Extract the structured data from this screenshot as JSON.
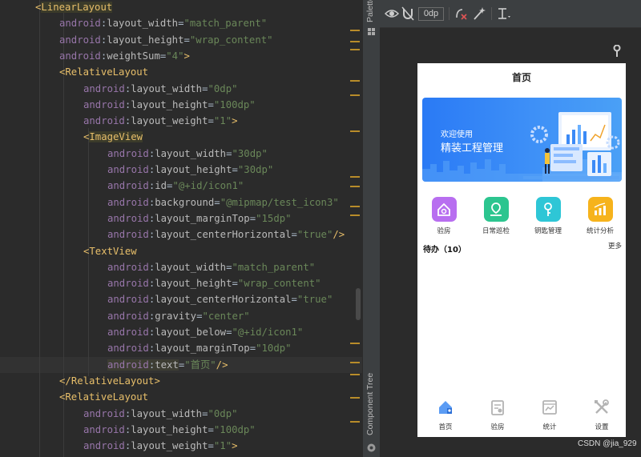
{
  "editor": {
    "lines": [
      [
        [
          "tok-punct",
          "<"
        ],
        [
          "tok-tag hl-tag",
          "LinearLayout"
        ]
      ],
      [
        [
          "tok-ns",
          "android"
        ],
        [
          "tok-eq",
          ":"
        ],
        [
          "tok-attr",
          "layout_width"
        ],
        [
          "tok-eq",
          "="
        ],
        [
          "tok-str",
          "\"match_parent\""
        ]
      ],
      [
        [
          "tok-ns",
          "android"
        ],
        [
          "tok-eq",
          ":"
        ],
        [
          "tok-attr",
          "layout_height"
        ],
        [
          "tok-eq",
          "="
        ],
        [
          "tok-str",
          "\"wrap_content\""
        ]
      ],
      [
        [
          "tok-ns",
          "android"
        ],
        [
          "tok-eq",
          ":"
        ],
        [
          "tok-attr",
          "weightSum"
        ],
        [
          "tok-eq",
          "="
        ],
        [
          "tok-str",
          "\"4\""
        ],
        [
          "tok-punct",
          ">"
        ]
      ],
      [
        [
          "tok-punct",
          "<"
        ],
        [
          "tok-tag",
          "RelativeLayout"
        ]
      ],
      [
        [
          "tok-ns",
          "android"
        ],
        [
          "tok-eq",
          ":"
        ],
        [
          "tok-attr",
          "layout_width"
        ],
        [
          "tok-eq",
          "="
        ],
        [
          "tok-str",
          "\"0dp\""
        ]
      ],
      [
        [
          "tok-ns",
          "android"
        ],
        [
          "tok-eq",
          ":"
        ],
        [
          "tok-attr",
          "layout_height"
        ],
        [
          "tok-eq",
          "="
        ],
        [
          "tok-str",
          "\"100dp\""
        ]
      ],
      [
        [
          "tok-ns",
          "android"
        ],
        [
          "tok-eq",
          ":"
        ],
        [
          "tok-attr",
          "layout_weight"
        ],
        [
          "tok-eq",
          "="
        ],
        [
          "tok-str",
          "\"1\""
        ],
        [
          "tok-punct",
          ">"
        ]
      ],
      [
        [
          "tok-punct",
          "<"
        ],
        [
          "tok-tag hl-tag",
          "ImageView"
        ]
      ],
      [
        [
          "tok-ns",
          "android"
        ],
        [
          "tok-eq",
          ":"
        ],
        [
          "tok-attr",
          "layout_width"
        ],
        [
          "tok-eq",
          "="
        ],
        [
          "tok-str",
          "\"30dp\""
        ]
      ],
      [
        [
          "tok-ns",
          "android"
        ],
        [
          "tok-eq",
          ":"
        ],
        [
          "tok-attr",
          "layout_height"
        ],
        [
          "tok-eq",
          "="
        ],
        [
          "tok-str",
          "\"30dp\""
        ]
      ],
      [
        [
          "tok-ns",
          "android"
        ],
        [
          "tok-eq",
          ":"
        ],
        [
          "tok-attr",
          "id"
        ],
        [
          "tok-eq",
          "="
        ],
        [
          "tok-str",
          "\"@+id/icon1\""
        ]
      ],
      [
        [
          "tok-ns",
          "android"
        ],
        [
          "tok-eq",
          ":"
        ],
        [
          "tok-attr",
          "background"
        ],
        [
          "tok-eq",
          "="
        ],
        [
          "tok-str",
          "\"@mipmap/test_icon3\""
        ]
      ],
      [
        [
          "tok-ns",
          "android"
        ],
        [
          "tok-eq",
          ":"
        ],
        [
          "tok-attr",
          "layout_marginTop"
        ],
        [
          "tok-eq",
          "="
        ],
        [
          "tok-str",
          "\"15dp\""
        ]
      ],
      [
        [
          "tok-ns",
          "android"
        ],
        [
          "tok-eq",
          ":"
        ],
        [
          "tok-attr",
          "layout_centerHorizontal"
        ],
        [
          "tok-eq",
          "="
        ],
        [
          "tok-str",
          "\"true\""
        ],
        [
          "tok-punct",
          "/>"
        ]
      ],
      [
        [
          "tok-punct",
          "<"
        ],
        [
          "tok-tag",
          "TextView"
        ]
      ],
      [
        [
          "tok-ns",
          "android"
        ],
        [
          "tok-eq",
          ":"
        ],
        [
          "tok-attr",
          "layout_width"
        ],
        [
          "tok-eq",
          "="
        ],
        [
          "tok-str",
          "\"match_parent\""
        ]
      ],
      [
        [
          "tok-ns",
          "android"
        ],
        [
          "tok-eq",
          ":"
        ],
        [
          "tok-attr",
          "layout_height"
        ],
        [
          "tok-eq",
          "="
        ],
        [
          "tok-str",
          "\"wrap_content\""
        ]
      ],
      [
        [
          "tok-ns",
          "android"
        ],
        [
          "tok-eq",
          ":"
        ],
        [
          "tok-attr",
          "layout_centerHorizontal"
        ],
        [
          "tok-eq",
          "="
        ],
        [
          "tok-str",
          "\"true\""
        ]
      ],
      [
        [
          "tok-ns",
          "android"
        ],
        [
          "tok-eq",
          ":"
        ],
        [
          "tok-attr",
          "gravity"
        ],
        [
          "tok-eq",
          "="
        ],
        [
          "tok-str",
          "\"center\""
        ]
      ],
      [
        [
          "tok-ns",
          "android"
        ],
        [
          "tok-eq",
          ":"
        ],
        [
          "tok-attr",
          "layout_below"
        ],
        [
          "tok-eq",
          "="
        ],
        [
          "tok-str",
          "\"@+id/icon1\""
        ]
      ],
      [
        [
          "tok-ns",
          "android"
        ],
        [
          "tok-eq",
          ":"
        ],
        [
          "tok-attr",
          "layout_marginTop"
        ],
        [
          "tok-eq",
          "="
        ],
        [
          "tok-str",
          "\"10dp\""
        ]
      ],
      [
        [
          "tok-ns hl-text",
          "android"
        ],
        [
          "tok-eq hl-text",
          ":"
        ],
        [
          "tok-attr hl-text",
          "text"
        ],
        [
          "tok-eq",
          "="
        ],
        [
          "tok-str",
          "\"首页\""
        ],
        [
          "tok-punct",
          "/>"
        ]
      ],
      [
        [
          "tok-punct",
          "</"
        ],
        [
          "tok-tag",
          "RelativeLayout"
        ],
        [
          "tok-punct",
          ">"
        ]
      ],
      [
        [
          "tok-punct",
          "<"
        ],
        [
          "tok-tag",
          "RelativeLayout"
        ]
      ],
      [
        [
          "tok-ns",
          "android"
        ],
        [
          "tok-eq",
          ":"
        ],
        [
          "tok-attr",
          "layout_width"
        ],
        [
          "tok-eq",
          "="
        ],
        [
          "tok-str",
          "\"0dp\""
        ]
      ],
      [
        [
          "tok-ns",
          "android"
        ],
        [
          "tok-eq",
          ":"
        ],
        [
          "tok-attr",
          "layout_height"
        ],
        [
          "tok-eq",
          "="
        ],
        [
          "tok-str",
          "\"100dp\""
        ]
      ],
      [
        [
          "tok-ns",
          "android"
        ],
        [
          "tok-eq",
          ":"
        ],
        [
          "tok-attr",
          "layout_weight"
        ],
        [
          "tok-eq",
          "="
        ],
        [
          "tok-str",
          "\"1\""
        ],
        [
          "tok-punct",
          ">"
        ]
      ]
    ]
  },
  "side_panel": {
    "palette_label": "Palette",
    "component_tree_label": "Component Tree"
  },
  "toolbar": {
    "margin_value": "0dp"
  },
  "phone": {
    "title": "首页",
    "banner": {
      "subtitle": "欢迎使用",
      "title": "精装工程管理"
    },
    "entries": [
      {
        "label": "验房",
        "icon": "house-check-icon",
        "color": "#b86ef0"
      },
      {
        "label": "日常巡检",
        "icon": "location-pin-icon",
        "color": "#2cc58f"
      },
      {
        "label": "钥匙管理",
        "icon": "key-icon",
        "color": "#2ec6d6"
      },
      {
        "label": "统计分析",
        "icon": "bar-chart-icon",
        "color": "#f6b31c"
      }
    ],
    "todo_label": "待办（10）",
    "more_label": "更多",
    "nav": [
      {
        "label": "首页",
        "icon": "home-icon",
        "active": true
      },
      {
        "label": "验房",
        "icon": "clipboard-icon",
        "active": false
      },
      {
        "label": "统计",
        "icon": "chart-window-icon",
        "active": false
      },
      {
        "label": "设置",
        "icon": "tools-icon",
        "active": false
      }
    ]
  },
  "watermark": "CSDN @jia_929"
}
